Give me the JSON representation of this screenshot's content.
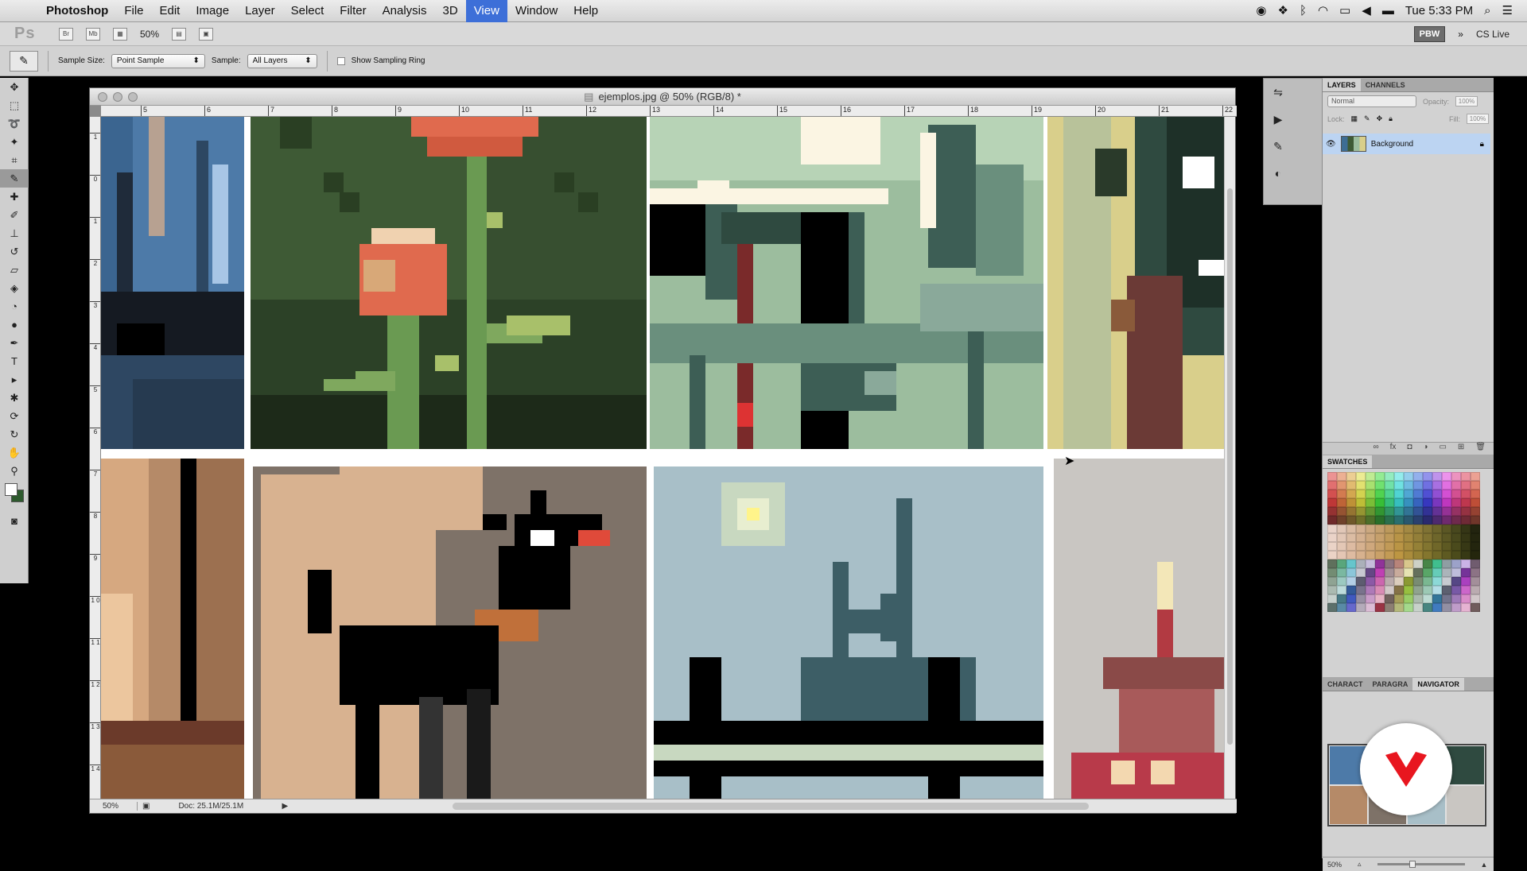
{
  "menubar": {
    "app": "Photoshop",
    "items": [
      "File",
      "Edit",
      "Image",
      "Layer",
      "Select",
      "Filter",
      "Analysis",
      "3D",
      "View",
      "Window",
      "Help"
    ],
    "active": "View",
    "clock": "Tue 5:33 PM"
  },
  "appbar": {
    "logo": "Ps",
    "zoom": "50%",
    "br": "Br",
    "mb": "Mb",
    "workspace": "PBW",
    "cs_live": "CS Live"
  },
  "options": {
    "sample_size_label": "Sample Size:",
    "sample_size_value": "Point Sample",
    "sample_label": "Sample:",
    "sample_value": "All Layers",
    "show_ring_label": "Show Sampling Ring"
  },
  "document": {
    "title": "ejemplos.jpg @ 50% (RGB/8) *",
    "zoom": "50%",
    "doc_size": "Doc: 25.1M/25.1M",
    "ruler_h": [
      "5",
      "6",
      "7",
      "8",
      "9",
      "10",
      "11",
      "12",
      "13",
      "14",
      "15",
      "16",
      "17",
      "18",
      "19",
      "20",
      "21",
      "22"
    ],
    "ruler_v": [
      "1",
      "0",
      "1",
      "2",
      "3",
      "4",
      "5",
      "6",
      "7",
      "8",
      "9",
      "1 0",
      "1 1",
      "1 2",
      "1 3",
      "1 4"
    ]
  },
  "panels": {
    "layers_tab": "LAYERS",
    "channels_tab": "CHANNELS",
    "blend_mode": "Normal",
    "opacity_label": "Opacity:",
    "opacity_value": "100%",
    "lock_label": "Lock:",
    "fill_label": "Fill:",
    "fill_value": "100%",
    "layer_name": "Background",
    "swatches_tab": "SWATCHES",
    "character_tab": "CHARACT",
    "paragraph_tab": "PARAGRA",
    "navigator_tab": "NAVIGATOR",
    "nav_zoom": "50%"
  },
  "colors": {
    "menu_highlight": "#3d6fd8",
    "layer_selected": "#bcd4f2",
    "fg_color": "#ffffff",
    "bg_color": "#2e5a2e"
  }
}
